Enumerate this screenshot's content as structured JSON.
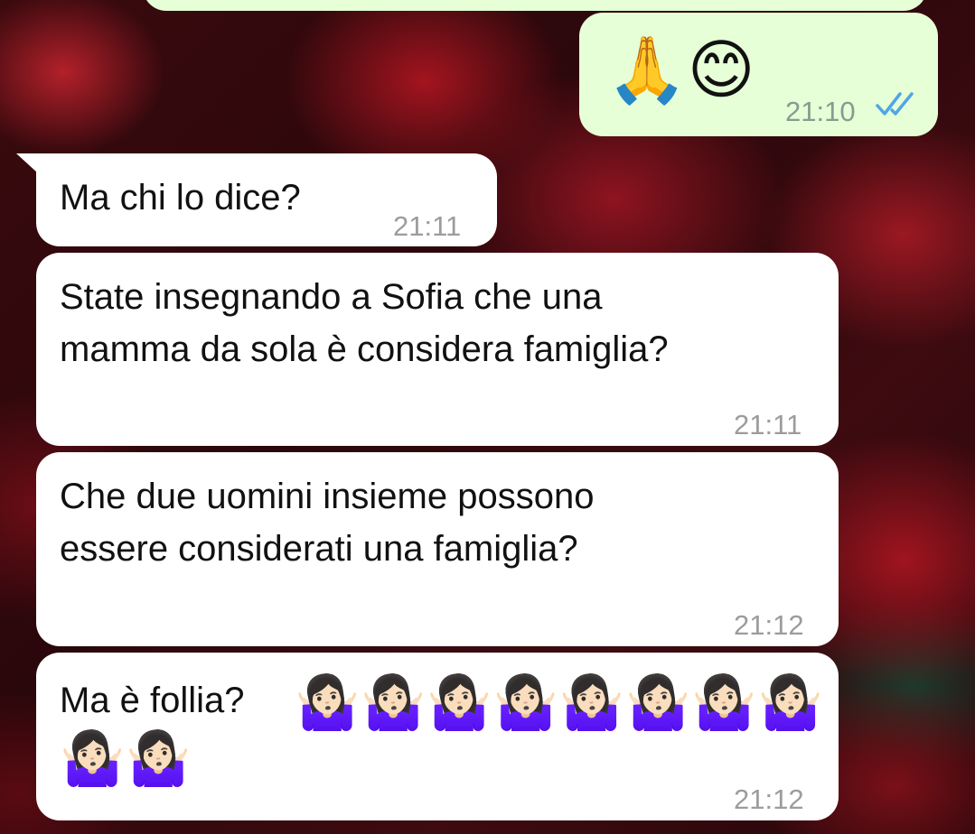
{
  "messages": [
    {
      "direction": "out",
      "text": "",
      "emoji": "🙏😊",
      "time": "21:10",
      "status": "read"
    },
    {
      "direction": "in",
      "text": "Ma chi lo dice?",
      "time": "21:11"
    },
    {
      "direction": "in",
      "text": "State insegnando a Sofia che una\nmamma da sola è considera famiglia?",
      "time": "21:11"
    },
    {
      "direction": "in",
      "text": "Che due uomini insieme possono\nessere considerati una famiglia?",
      "time": "21:12"
    },
    {
      "direction": "in",
      "text": "Ma è follia?",
      "emoji": "🤷🏻‍♀️🤷🏻‍♀️🤷🏻‍♀️🤷🏻‍♀️🤷🏻‍♀️🤷🏻‍♀️🤷🏻‍♀️🤷🏻‍♀️🤷🏻‍♀️🤷🏻‍♀️",
      "time": "21:12"
    }
  ],
  "colors": {
    "incoming": "#ffffff",
    "outgoing": "#e6ffd7",
    "read_ticks": "#4fa6e6"
  }
}
